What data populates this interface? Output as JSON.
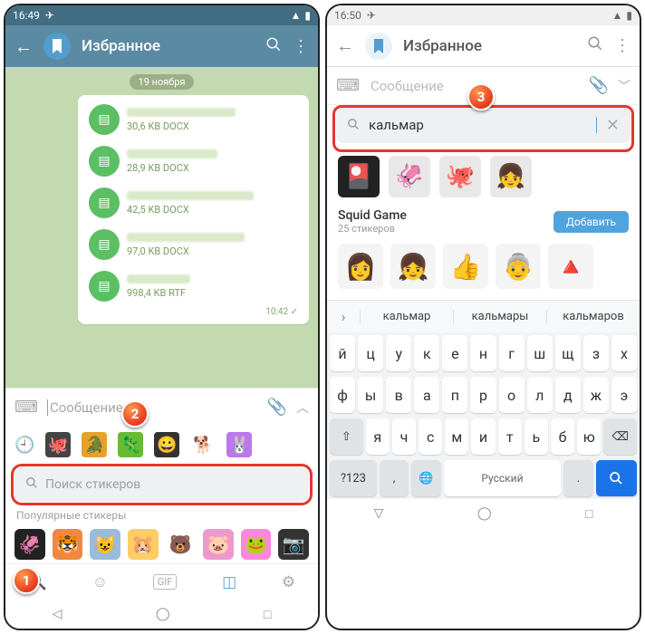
{
  "left": {
    "status_time": "16:49",
    "appbar_title": "Избранное",
    "date_pill": "19 ноября",
    "files": [
      {
        "size": "30,6 KB DOCX"
      },
      {
        "size": "28,9 KB DOCX"
      },
      {
        "size": "42,5 KB DOCX"
      },
      {
        "size": "97,0 KB DOCX"
      },
      {
        "size": "998,4 KB RTF"
      }
    ],
    "msg_time": "10:42 ✓",
    "message_placeholder": "Сообщение",
    "sticker_search_placeholder": "Поиск стикеров",
    "popular_label": "Популярные стикеры",
    "callouts": {
      "one": "1",
      "two": "2"
    }
  },
  "right": {
    "status_time": "16:50",
    "appbar_title": "Избранное",
    "message_placeholder": "Сообщение",
    "search_value": "кальмар",
    "pack_name": "Squid Game",
    "pack_count": "25 стикеров",
    "add_button": "Добавить",
    "suggestions": [
      "кальмар",
      "кальмары",
      "кальмаров"
    ],
    "kbd_rows": [
      [
        "й",
        "ц",
        "у",
        "к",
        "е",
        "н",
        "г",
        "ш",
        "щ",
        "з",
        "х"
      ],
      [
        "ф",
        "ы",
        "в",
        "а",
        "п",
        "р",
        "о",
        "л",
        "д",
        "ж",
        "э"
      ],
      [
        "я",
        "ч",
        "с",
        "м",
        "и",
        "т",
        "ь",
        "б",
        "ю"
      ]
    ],
    "kbd_sym": "?123",
    "kbd_lang": "Русский",
    "callouts": {
      "three": "3"
    }
  }
}
